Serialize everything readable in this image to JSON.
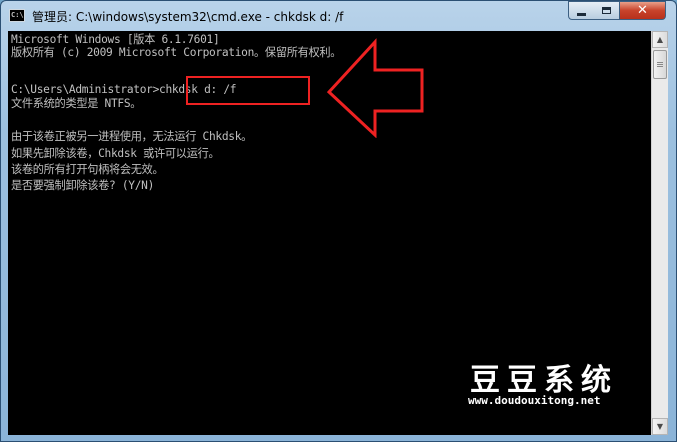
{
  "window": {
    "title": "管理员: C:\\windows\\system32\\cmd.exe - chkdsk  d: /f",
    "icon": "cmd-icon",
    "icon_text": "C:\\",
    "controls": [
      "minimize-icon",
      "maximize-icon",
      "close-icon"
    ]
  },
  "console": {
    "lines": [
      "Microsoft Windows [版本 6.1.7601]",
      "版权所有 (c) 2009 Microsoft Corporation。保留所有权利。",
      "",
      "C:\\Users\\Administrator>chkdsk d: /f",
      "文件系统的类型是 NTFS。",
      "",
      "由于该卷正被另一进程使用，无法运行 Chkdsk。",
      "如果先卸除该卷，Chkdsk 或许可以运行。",
      "该卷的所有打开句柄将会无效。",
      "是否要强制卸除该卷? (Y/N)"
    ],
    "text_color": "#c0c0c0",
    "background": "#000000"
  },
  "annotation": {
    "color": "#ee2222",
    "icon": "arrow-left-icon"
  },
  "watermark": {
    "logo": "豆豆系统",
    "url": "www.doudouxitong.net"
  }
}
